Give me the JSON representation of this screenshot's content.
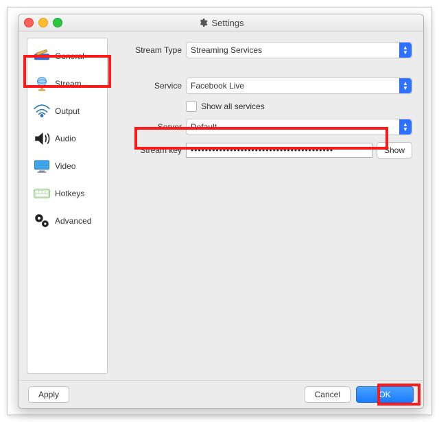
{
  "window": {
    "title": "Settings"
  },
  "sidebar": {
    "items": [
      {
        "label": "General"
      },
      {
        "label": "Stream"
      },
      {
        "label": "Output"
      },
      {
        "label": "Audio"
      },
      {
        "label": "Video"
      },
      {
        "label": "Hotkeys"
      },
      {
        "label": "Advanced"
      }
    ]
  },
  "form": {
    "stream_type_label": "Stream Type",
    "stream_type_value": "Streaming Services",
    "service_label": "Service",
    "service_value": "Facebook Live",
    "show_all_label": "Show all services",
    "server_label": "Server",
    "server_value": "Default",
    "stream_key_label": "Stream key",
    "stream_key_mask": "••••••••••••••••••••••••••••••••••••••••",
    "show_button": "Show"
  },
  "footer": {
    "apply": "Apply",
    "cancel": "Cancel",
    "ok": "OK"
  }
}
